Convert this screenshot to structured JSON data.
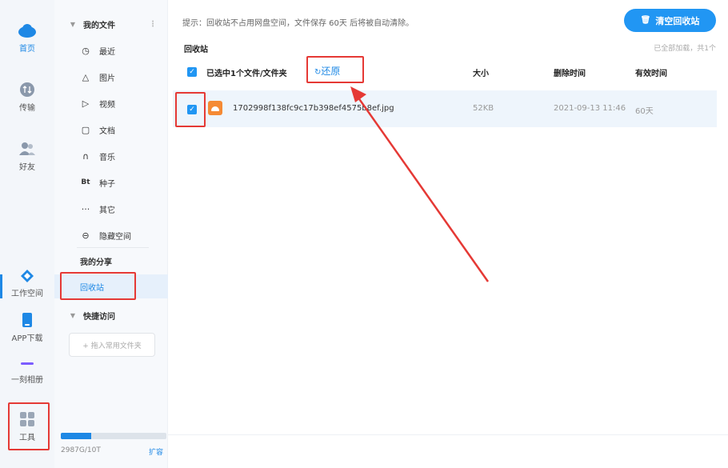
{
  "rail": {
    "items": [
      {
        "label": "首页",
        "icon": "cloud-icon"
      },
      {
        "label": "传输",
        "icon": "transfer-icon"
      },
      {
        "label": "好友",
        "icon": "friends-icon"
      },
      {
        "label": "工作空间",
        "icon": "workspace-icon"
      },
      {
        "label": "APP下载",
        "icon": "phone-icon"
      },
      {
        "label": "一刻相册",
        "icon": "album-icon"
      },
      {
        "label": "工具",
        "icon": "tools-icon"
      }
    ]
  },
  "sidebar": {
    "my_files": "我的文件",
    "items": [
      {
        "label": "最近",
        "glyph": "◷"
      },
      {
        "label": "图片",
        "glyph": "△"
      },
      {
        "label": "视频",
        "glyph": "▷"
      },
      {
        "label": "文档",
        "glyph": "▢"
      },
      {
        "label": "音乐",
        "glyph": "∩"
      },
      {
        "label": "种子",
        "glyph": "Bt"
      },
      {
        "label": "其它",
        "glyph": "···"
      },
      {
        "label": "隐藏空间",
        "glyph": "⊖"
      }
    ],
    "my_share": "我的分享",
    "recycle": "回收站",
    "quick_access": "快捷访问",
    "quick_drop_hint": "+ 拖入常用文件夹",
    "storage_text": "2987G/10T",
    "storage_used_fraction": 0.29,
    "expand": "扩容"
  },
  "main": {
    "tip": "提示：回收站不占用网盘空间，文件保存 60天 后将被自动清除。",
    "clear_button": "清空回收站",
    "section_title": "回收站",
    "loaded_text": "已全部加载，共1个",
    "header": {
      "selected": "已选中1个文件/文件夹",
      "restore": "还原",
      "size": "大小",
      "deleted_time": "删除时间",
      "valid_time": "有效时间"
    },
    "rows": [
      {
        "name": "1702998f138fc9c17b398ef4575b8ef.jpg",
        "size": "52KB",
        "deleted": "2021-09-13 11:46",
        "valid": "60天"
      }
    ]
  },
  "colors": {
    "accent": "#1e88e5",
    "highlight_box": "#e53935",
    "file_icon": "#f58a34"
  }
}
